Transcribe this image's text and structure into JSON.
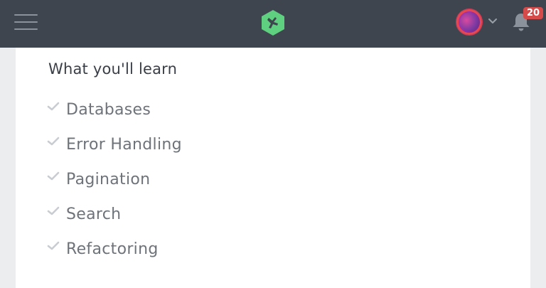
{
  "header": {
    "notifications_count": "20",
    "icons": {
      "menu": "hamburger-menu-icon",
      "logo": "treehouse-logo-icon",
      "avatar": "user-avatar",
      "dropdown": "chevron-down-icon",
      "notifications": "bell-icon"
    },
    "colors": {
      "bar": "#3f454f",
      "logo": "#5fcf80",
      "badge": "#d64a4a"
    }
  },
  "main": {
    "heading": "What you'll learn",
    "items": [
      {
        "label": "Databases"
      },
      {
        "label": "Error Handling"
      },
      {
        "label": "Pagination"
      },
      {
        "label": "Search"
      },
      {
        "label": "Refactoring"
      }
    ],
    "item_icon": "check-icon",
    "colors": {
      "check": "#c9ccd0",
      "text": "#6e737a"
    }
  }
}
